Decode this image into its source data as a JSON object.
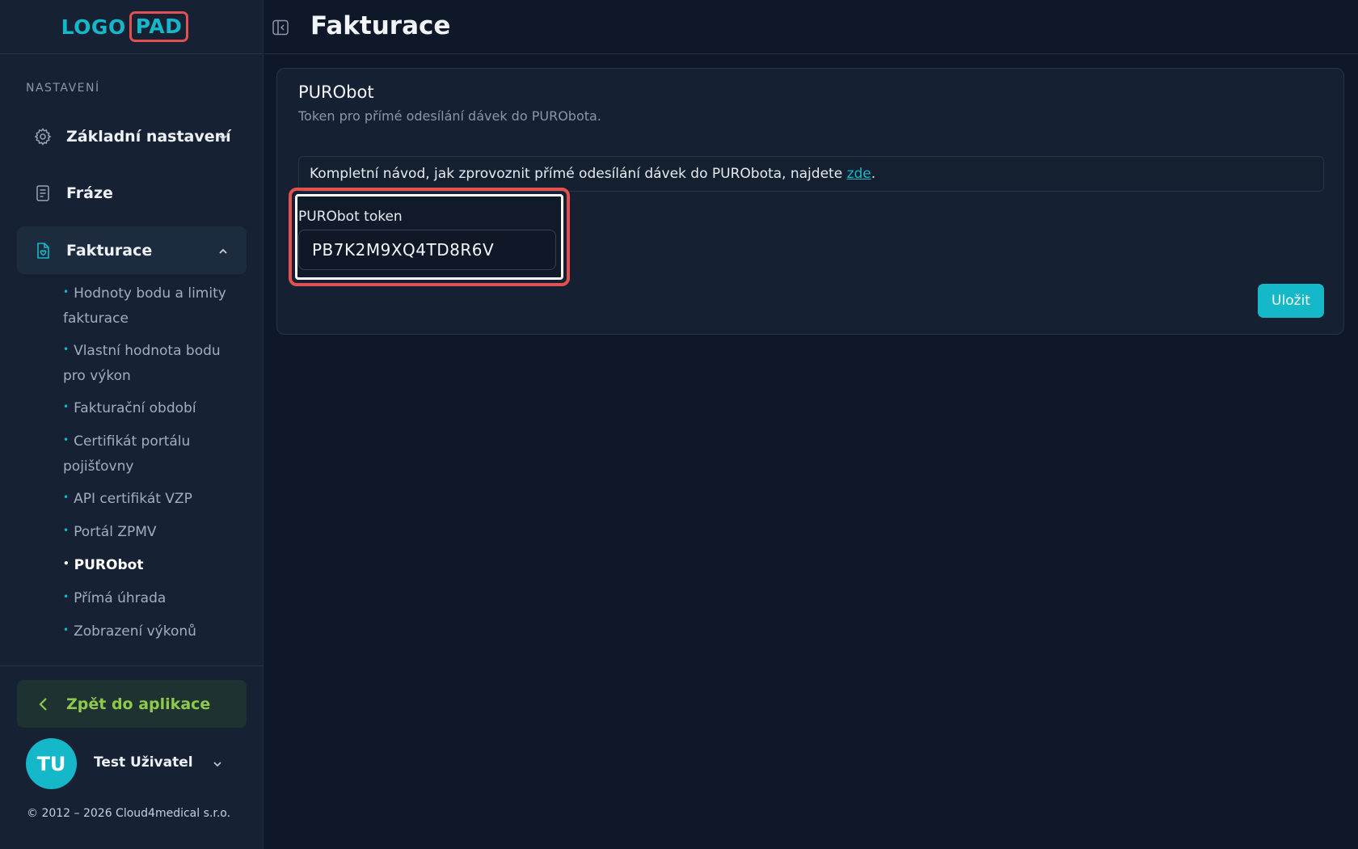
{
  "logo": {
    "part_a": "LOGO",
    "part_b": "PAD"
  },
  "header": {
    "title": "Fakturace"
  },
  "sidebar": {
    "section_label": "NASTAVENÍ",
    "items": [
      {
        "label": "Základní nastavení",
        "icon": "gear-icon"
      },
      {
        "label": "Fráze",
        "icon": "document-icon"
      },
      {
        "label": "Fakturace",
        "icon": "invoice-icon"
      }
    ],
    "sub_items": [
      "Hodnoty bodu a limity fakturace",
      "Vlastní hodnota bodu pro výkon",
      "Fakturační období",
      "Certifikát portálu pojišťovny",
      "API certifikát VZP",
      "Portál ZPMV",
      "PURObot",
      "Přímá úhrada",
      "Zobrazení výkonů"
    ],
    "current_sub": "PURObot",
    "back_label": "Zpět do aplikace",
    "user": {
      "initials": "TU",
      "name": "Test Uživatel"
    },
    "copyright": "© 2012 – 2026 Cloud4medical s.r.o."
  },
  "card": {
    "title": "PURObot",
    "subtitle": "Token pro přímé odesílání dávek do PURObota.",
    "info_text": "Kompletní návod, jak zprovoznit přímé odesílání dávek do PURObota, najdete ",
    "info_link": "zde",
    "info_end": ".",
    "token_label": "PURObot token",
    "token_value": "PB7K2M9XQ4TD8R6V",
    "save_label": "Uložit"
  },
  "colors": {
    "accent": "#14b8c8",
    "highlight": "#e2504f",
    "back_text": "#8fc94b",
    "background": "#0f1828",
    "sidebar": "#162133"
  }
}
